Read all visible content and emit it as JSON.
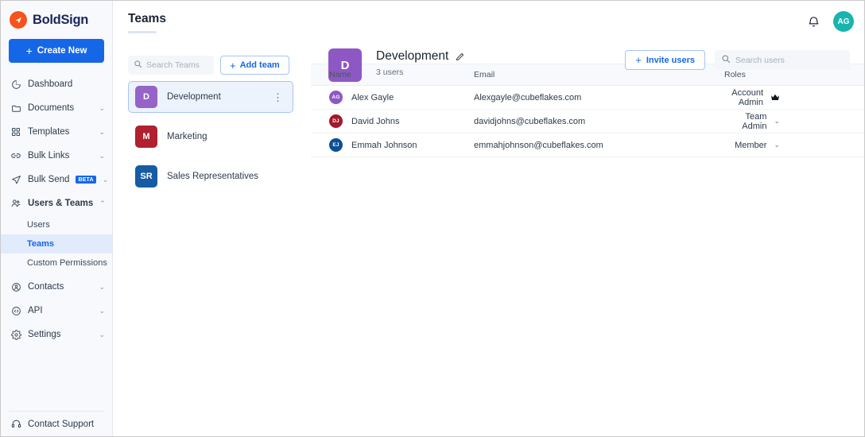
{
  "brand": {
    "name": "BoldSign",
    "logo_icon": "boldsign-arrow-logo"
  },
  "sidebar": {
    "create_new_label": "Create New",
    "items": [
      {
        "label": "Dashboard",
        "icon": "dashboard-pie-icon",
        "chevron": false,
        "badge": null
      },
      {
        "label": "Documents",
        "icon": "folder-icon",
        "chevron": true,
        "badge": null
      },
      {
        "label": "Templates",
        "icon": "grid-icon",
        "chevron": true,
        "badge": null
      },
      {
        "label": "Bulk Links",
        "icon": "link-icon",
        "chevron": true,
        "badge": null
      },
      {
        "label": "Bulk Send",
        "icon": "send-paper-plane-icon",
        "chevron": true,
        "badge": "BETA"
      },
      {
        "label": "Users & Teams",
        "icon": "users-icon",
        "chevron": true,
        "badge": null,
        "expanded": true
      },
      {
        "label": "Contacts",
        "icon": "contact-circle-icon",
        "chevron": true,
        "badge": null
      },
      {
        "label": "API",
        "icon": "api-code-icon",
        "chevron": true,
        "badge": null
      },
      {
        "label": "Settings",
        "icon": "gear-icon",
        "chevron": true,
        "badge": null
      }
    ],
    "subitems": [
      {
        "label": "Users",
        "selected": false
      },
      {
        "label": "Teams",
        "selected": true
      },
      {
        "label": "Custom Permissions",
        "selected": false
      }
    ],
    "contact_support": {
      "label": "Contact Support",
      "icon": "headset-icon"
    }
  },
  "topbar": {
    "notification_icon": "bell-icon",
    "avatar_initials": "AG",
    "avatar_color": "#18b5b0"
  },
  "teams_panel": {
    "title": "Teams",
    "search": {
      "placeholder": "Search Teams",
      "value": "",
      "icon": "search-icon"
    },
    "add_team_label": "Add team",
    "annotation_arrow": {
      "color": "#f4641e",
      "points_to": "add-team-button"
    },
    "teams": [
      {
        "initials": "D",
        "name": "Development",
        "color": "#9664c8",
        "selected": true
      },
      {
        "initials": "M",
        "name": "Marketing",
        "color": "#b0202f",
        "selected": false
      },
      {
        "initials": "SR",
        "name": "Sales Representatives",
        "color": "#175ba3",
        "selected": false
      }
    ]
  },
  "team_detail": {
    "avatar_initials": "D",
    "avatar_color": "#8e58c4",
    "name": "Development",
    "edit_icon": "pencil-edit-icon",
    "users_count_label": "3 users",
    "invite_users_label": "Invite users",
    "search_users": {
      "placeholder": "Search users",
      "value": "",
      "icon": "search-icon"
    },
    "table": {
      "columns": [
        "Name",
        "Email",
        "Roles"
      ],
      "rows": [
        {
          "initials": "AG",
          "avatar_color": "#8e58c4",
          "name": "Alex Gayle",
          "email": "Alexgayle@cubeflakes.com",
          "role": "Account Admin",
          "role_marker": "crown-icon"
        },
        {
          "initials": "DJ",
          "avatar_color": "#a3182c",
          "name": "David Johns",
          "email": "davidjohns@cubeflakes.com",
          "role": "Team Admin",
          "role_marker": "chevron-down-icon"
        },
        {
          "initials": "EJ",
          "avatar_color": "#0d4f93",
          "name": "Emmah Johnson",
          "email": "emmahjohnson@cubeflakes.com",
          "role": "Member",
          "role_marker": "chevron-down-icon"
        }
      ]
    }
  },
  "colors": {
    "primary_blue": "#1667e8",
    "brand_orange": "#f8521c",
    "annotation_orange": "#f4641e",
    "sidebar_bg": "#f7f9fc",
    "selected_subnav_bg": "#e1ebfb"
  }
}
